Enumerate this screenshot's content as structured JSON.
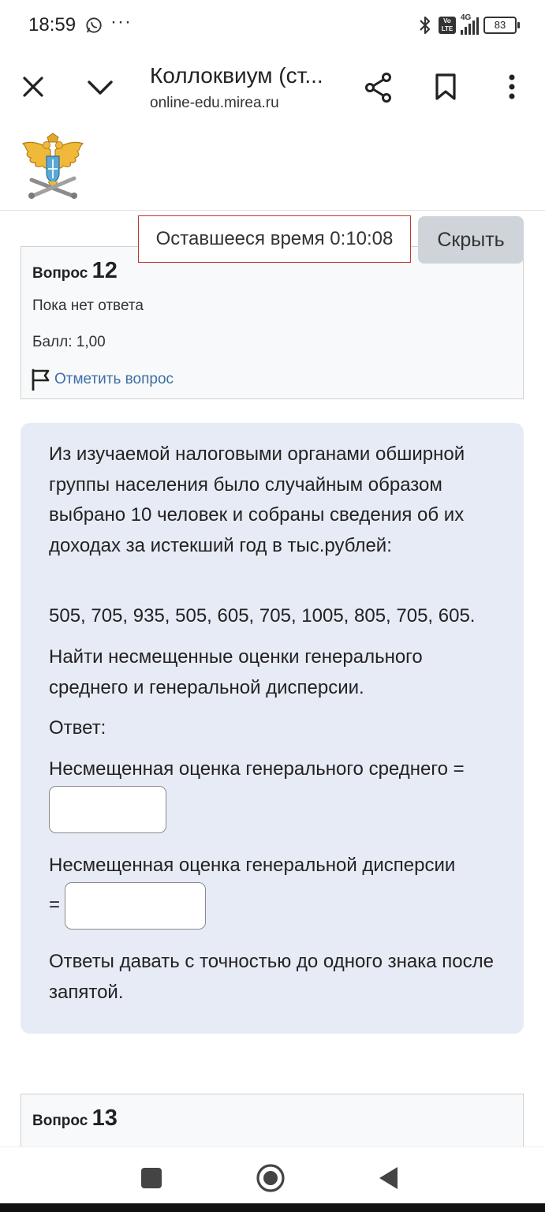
{
  "status": {
    "time": "18:59",
    "dots": "···",
    "network": "4G",
    "volte": "Vo LTE",
    "battery": "83"
  },
  "browser": {
    "title": "Коллоквиум (ст...",
    "url": "online-edu.mirea.ru"
  },
  "timer": {
    "text": "Оставшееся время 0:10:08",
    "hide_label": "Скрыть"
  },
  "question12": {
    "label": "Вопрос",
    "number": "12",
    "status": "Пока нет ответа",
    "score": "Балл: 1,00",
    "flag_label": "Отметить вопрос",
    "intro": "Из изучаемой налоговыми органами обширной группы населения было случайным образом выбрано 10 человек и собраны сведения об их доходах за истекший год в тыс.рублей:",
    "data": "505, 705, 935, 505, 605, 705, 1005, 805, 705, 605.",
    "task": "Найти несмещенные оценки генерального среднего и генеральной дисперсии.",
    "answer_label": "Ответ:",
    "mean_label": "Несмещенная оценка генерального среднего =",
    "mean_value": "",
    "var_label": "Несмещенная оценка генеральной дисперсии",
    "var_eq": "=",
    "var_value": "",
    "note": "Ответы давать с точностью до одного знака после запятой."
  },
  "question13": {
    "label": "Вопрос",
    "number": "13"
  },
  "colors": {
    "accent_link": "#3e6ea6",
    "timer_border": "#b83a2e",
    "content_bg": "#e7ebf5"
  },
  "icons": [
    "whatsapp-icon",
    "bluetooth-icon",
    "signal-icon",
    "battery-icon",
    "close-icon",
    "chevron-down-icon",
    "share-icon",
    "bookmark-icon",
    "more-vert-icon",
    "university-emblem-icon",
    "flag-icon",
    "nav-recents-icon",
    "nav-home-icon",
    "nav-back-icon"
  ]
}
